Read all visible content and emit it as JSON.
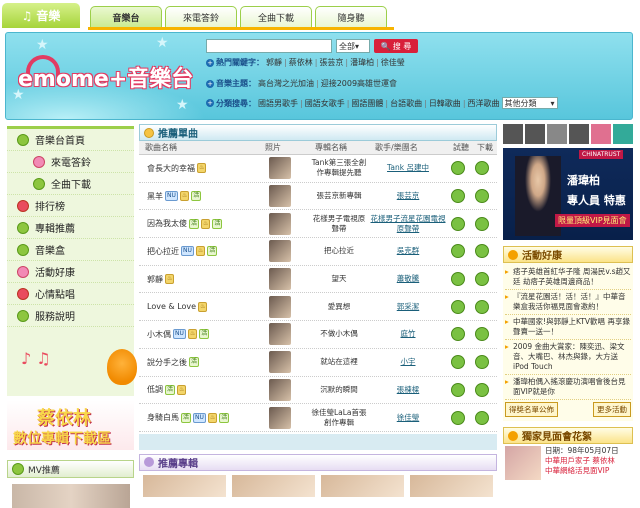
{
  "nav": {
    "logo_label": "音樂",
    "tabs": [
      "音樂台",
      "來電答鈴",
      "全曲下載",
      "隨身聽"
    ]
  },
  "banner": {
    "brand": "emome",
    "brand_plus": "+音樂台",
    "search": {
      "placeholder": "",
      "scope": "全部",
      "button": "搜 尋"
    },
    "hot_label": "熱門關鍵字：",
    "hot_keywords": [
      "郭靜",
      "蔡依林",
      "張芸京",
      "潘瑋柏",
      "徐佳瑩"
    ],
    "theme_label": "音樂主題：",
    "themes": [
      "高台灣之光加油",
      "迎接2009高雄世運會"
    ],
    "cat_label": "分類搜尋：",
    "categories": [
      "國語男歌手",
      "國語女歌手",
      "國語團體",
      "台語歌曲",
      "日韓歌曲",
      "西洋歌曲"
    ],
    "cat_select": "其他分類"
  },
  "sidebar": {
    "items": [
      "音樂台首頁",
      "來電答鈴",
      "全曲下載",
      "排行榜",
      "專輯推薦",
      "音樂盒",
      "活動好康",
      "心情點唱",
      "服務說明"
    ]
  },
  "promo_left": {
    "line1": "蔡依林",
    "line2": "數位專輯下載區"
  },
  "mv": {
    "title": "MV推薦"
  },
  "recommend": {
    "title": "推薦單曲",
    "columns": [
      "歌曲名稱",
      "照片",
      "專輯名稱",
      "歌手/樂團名",
      "試聽",
      "下載"
    ],
    "rows": [
      {
        "song": "會長大的幸福",
        "badges": [
          "hot"
        ],
        "album": "Tank第三張全創作專輯提先聽",
        "artist": "Tank 呂建中"
      },
      {
        "song": "黑羊",
        "badges": [
          "new",
          "hot",
          "plus"
        ],
        "album": "張芸京新專輯",
        "artist": "張芸京"
      },
      {
        "song": "因為我太傻",
        "badges": [
          "plus",
          "hot",
          "plus"
        ],
        "album": "花樣男子電視原聲帶",
        "artist": "花樣男子流星花園電視原聲帶"
      },
      {
        "song": "把心拉近",
        "badges": [
          "new",
          "hot",
          "plus"
        ],
        "album": "把心拉近",
        "artist": "吳克群"
      },
      {
        "song": "郭靜",
        "badges": [
          "hot"
        ],
        "album": "望天",
        "artist": "蕭敬騰"
      },
      {
        "song": "Love & Love",
        "badges": [
          "hot"
        ],
        "album": "愛異想",
        "artist": "郭采潔"
      },
      {
        "song": "小木偶",
        "badges": [
          "new",
          "hot",
          "plus"
        ],
        "album": "不做小木偶",
        "artist": "庭竹"
      },
      {
        "song": "說分手之後",
        "badges": [
          "plus"
        ],
        "album": "就站在這裡",
        "artist": "小宇"
      },
      {
        "song": "低調",
        "badges": [
          "plus",
          "hot"
        ],
        "album": "沉默的瞬間",
        "artist": "張棟樑"
      },
      {
        "song": "身騎白馬",
        "badges": [
          "plus",
          "new",
          "hot",
          "plus"
        ],
        "album": "徐佳瑩LaLa首張創作專輯",
        "artist": "徐佳瑩"
      }
    ]
  },
  "albums_section": {
    "title": "推薦專輯"
  },
  "promo_right": {
    "flag": "CHINATRUST",
    "name": "潘瑋柏",
    "text1": "專人員 特惠",
    "text2": "限量頂級VIP見面會"
  },
  "activity": {
    "title": "活動好康",
    "items": [
      "痞子英雄首紅华子隆 周湯民v.s趙又廷 劫痞子英雄周邊商品！",
      "『流星花園活！活！活！』中華音樂盒我活你福見面會邀約！",
      "中華國家!與郭靜上KTV歡唱 再享錄聲賣一送一！",
      "2009 金曲大賞家：陳奕迅、梁文音、大嘴巴、林杰與錄，大方送iPod Touch",
      "潘瑋柏偶入搖滾慶功演唱會後台見面VIP就是你"
    ],
    "more_label": "得獎名單公佈",
    "more_link": "更多活動"
  },
  "vip": {
    "title": "獨家見面會花絮",
    "date": "日期：98年05月07日",
    "line2": "中華用戶家子 蔡依林",
    "line3": "中華網絡活見面VIP"
  }
}
